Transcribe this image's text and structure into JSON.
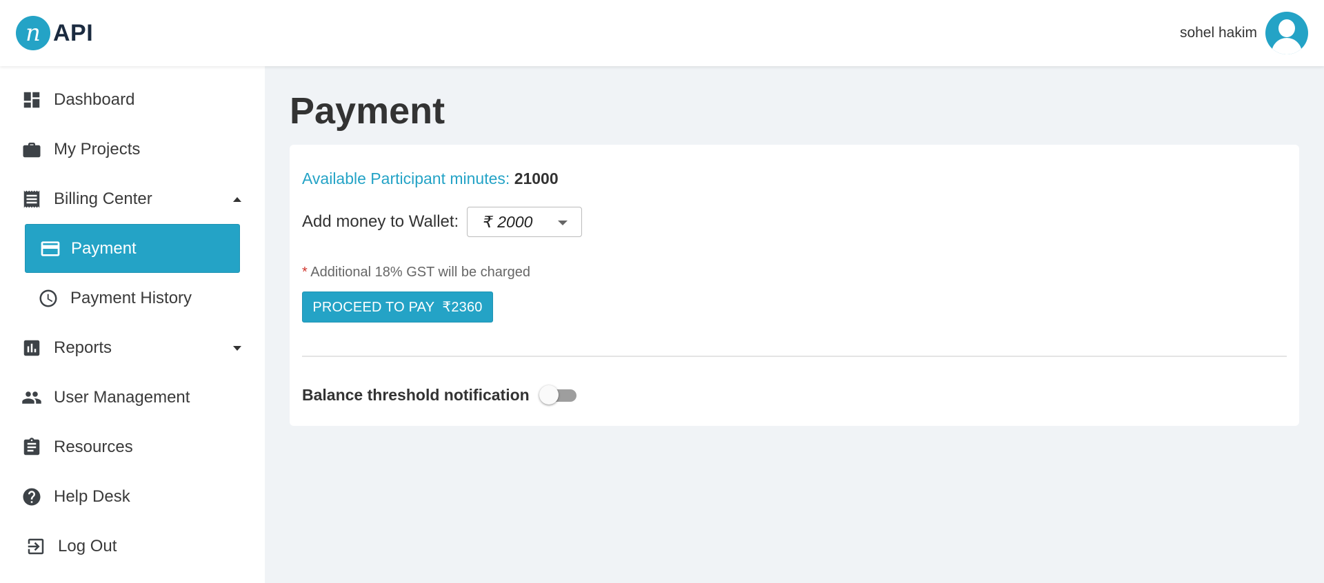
{
  "brand": {
    "logo_mark": "n",
    "logo_text": "API"
  },
  "user": {
    "name": "sohel hakim"
  },
  "sidebar": {
    "items": [
      {
        "label": "Dashboard",
        "icon": "dashboard-icon"
      },
      {
        "label": "My Projects",
        "icon": "briefcase-icon"
      },
      {
        "label": "Billing Center",
        "icon": "receipt-icon",
        "expanded": true
      },
      {
        "label": "Payment",
        "icon": "credit-card-icon",
        "active": true
      },
      {
        "label": "Payment History",
        "icon": "clock-icon"
      },
      {
        "label": "Reports",
        "icon": "bar-chart-icon",
        "expanded": false
      },
      {
        "label": "User Management",
        "icon": "people-icon"
      },
      {
        "label": "Resources",
        "icon": "clipboard-icon"
      },
      {
        "label": "Help Desk",
        "icon": "help-icon"
      },
      {
        "label": "Log Out",
        "icon": "logout-icon"
      }
    ]
  },
  "main": {
    "title": "Payment",
    "minutes_label": "Available Participant minutes:",
    "minutes_value": "21000",
    "wallet_label": "Add money to Wallet:",
    "wallet_amount": "₹ 2000",
    "gst_star": "*",
    "gst_note": "Additional 18% GST will be charged",
    "pay_button": "PROCEED TO PAY  ₹2360",
    "threshold_label": "Balance threshold notification",
    "threshold_enabled": false
  },
  "colors": {
    "accent": "#24a3c6",
    "background": "#f0f3f6",
    "text": "#333333",
    "required": "#d0342c"
  }
}
